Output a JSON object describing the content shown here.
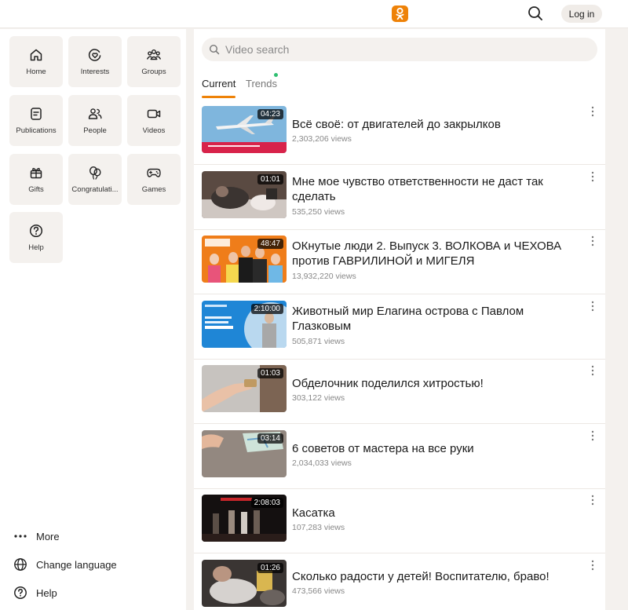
{
  "header": {
    "logo": "ok-logo",
    "search_icon": "search-icon",
    "login_label": "Log in"
  },
  "sidebar": {
    "tiles": [
      {
        "label": "Home",
        "icon": "home-icon"
      },
      {
        "label": "Interests",
        "icon": "interests-icon"
      },
      {
        "label": "Groups",
        "icon": "groups-icon"
      },
      {
        "label": "Publications",
        "icon": "publications-icon"
      },
      {
        "label": "People",
        "icon": "people-icon"
      },
      {
        "label": "Videos",
        "icon": "videos-icon"
      },
      {
        "label": "Gifts",
        "icon": "gift-icon"
      },
      {
        "label": "Congratulati...",
        "icon": "balloons-icon"
      },
      {
        "label": "Games",
        "icon": "gamepad-icon"
      },
      {
        "label": "Help",
        "icon": "help-icon"
      }
    ],
    "bottom_links": [
      {
        "label": "More",
        "icon": "more-icon"
      },
      {
        "label": "Change language",
        "icon": "globe-icon"
      },
      {
        "label": "Help",
        "icon": "help-icon"
      }
    ]
  },
  "main": {
    "search": {
      "placeholder": "Video search"
    },
    "tabs": [
      {
        "label": "Current",
        "active": true
      },
      {
        "label": "Trends",
        "active": false,
        "has_indicator": true
      }
    ],
    "videos": [
      {
        "title": "Всё своё: от двигателей до закрылков",
        "views": "2,303,206 views",
        "duration": "04:23"
      },
      {
        "title": "Мне мое чувство ответственности не даст так сделать",
        "views": "535,250 views",
        "duration": "01:01"
      },
      {
        "title": "ОКнутые люди 2. Выпуск 3. ВОЛКОВА и ЧЕХОВА против ГАВРИЛИНОЙ и МИГЕЛЯ",
        "views": "13,932,220 views",
        "duration": "48:47"
      },
      {
        "title": "Животный мир Елагина острова с Павлом Глазковым",
        "views": "505,871 views",
        "duration": "2:10:00"
      },
      {
        "title": "Обделочник поделился хитростью!",
        "views": "303,122 views",
        "duration": "01:03"
      },
      {
        "title": "6 советов от мастера на все руки",
        "views": "2,034,033 views",
        "duration": "03:14"
      },
      {
        "title": "Касатка",
        "views": "107,283 views",
        "duration": "2:08:03"
      },
      {
        "title": "Сколько радости у детей! Воспитателю, браво!",
        "views": "473,566 views",
        "duration": "01:26"
      }
    ]
  },
  "colors": {
    "accent": "#ee8208",
    "indicator": "#2fbf71",
    "tile_bg": "#f4f1ee"
  }
}
